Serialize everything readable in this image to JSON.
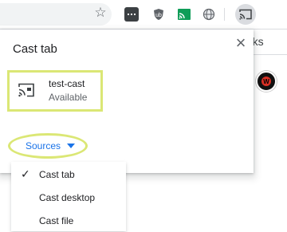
{
  "toolbar": {
    "icons": [
      "bookmark-star-icon",
      "dots-extension-icon",
      "ublock-icon",
      "cast-extension-icon",
      "globe-extension-icon",
      "cast-icon"
    ]
  },
  "background": {
    "bookmarks_partial": "rks"
  },
  "cast_dialog": {
    "title": "Cast tab",
    "close_icon": "close-icon",
    "sink": {
      "name": "test-cast",
      "status": "Available",
      "icon": "cast-device-icon"
    },
    "sources_label": "Sources",
    "highlight_color": "#dbe775",
    "accent_color": "#1a73e8"
  },
  "sources_menu": {
    "items": [
      {
        "label": "Cast tab",
        "checked": true
      },
      {
        "label": "Cast desktop",
        "checked": false
      },
      {
        "label": "Cast file",
        "checked": false
      }
    ],
    "check_glyph": "✓"
  }
}
